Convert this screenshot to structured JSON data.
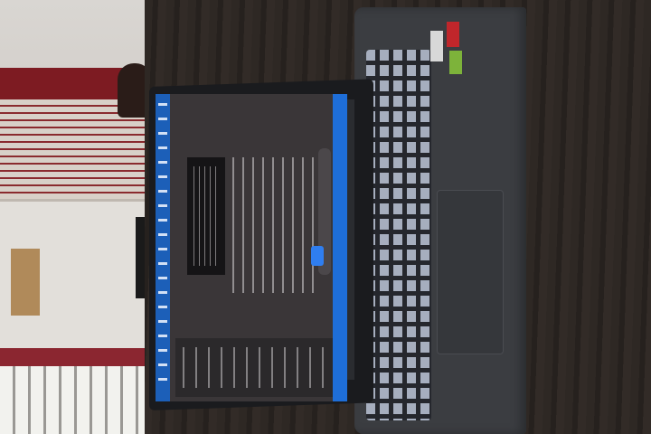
{
  "scene": {
    "description_type": "photo",
    "colors": {
      "desk": "#2e2824",
      "laptop_body": "#3b3d41",
      "screen_bg": "#3a3638",
      "taskbar": "#1c5fb8",
      "curtain": "#7d1b22",
      "keyboard_backlight": "#b9c2d4"
    }
  }
}
